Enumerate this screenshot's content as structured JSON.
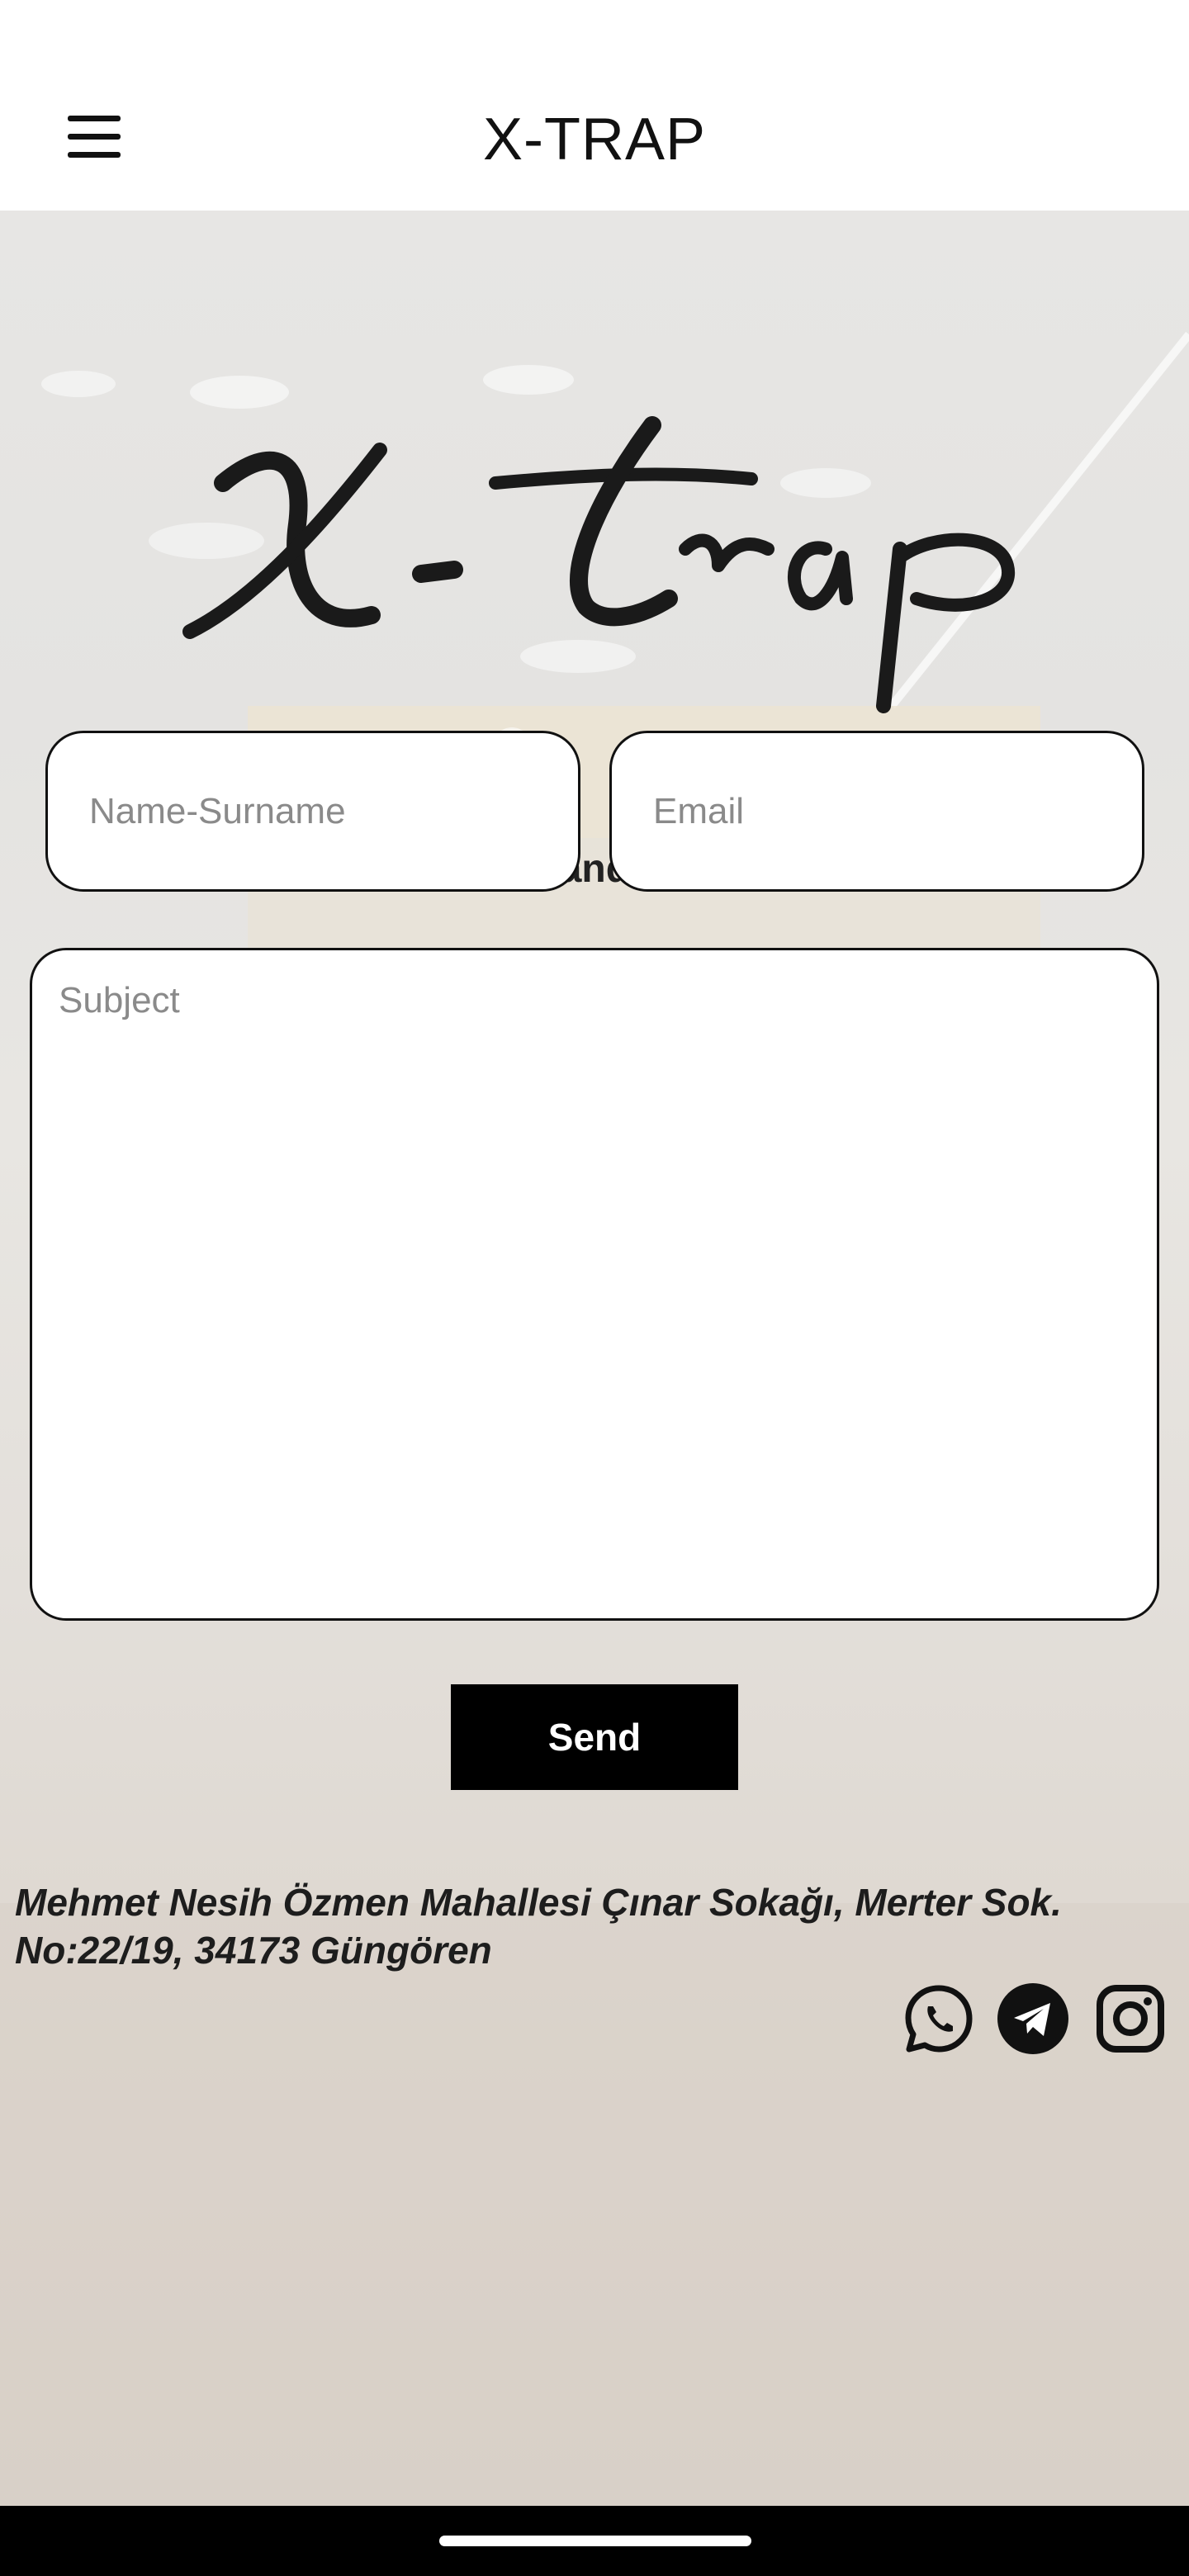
{
  "header": {
    "title": "X-TRAP",
    "menu_icon": "hamburger-menu-icon"
  },
  "logo": {
    "text": "X-Trap"
  },
  "intro": {
    "text": "To contact us, fill out and send the form below."
  },
  "form": {
    "name_placeholder": "Name-Surname",
    "email_placeholder": "Email",
    "subject_placeholder": "Subject",
    "send_label": "Send"
  },
  "footer": {
    "address_line1": "Mehmet Nesih Özmen Mahallesi Çınar Sokağı, Merter Sok.",
    "address_line2": "No:22/19, 34173 Güngören",
    "social": [
      "whatsapp-icon",
      "telegram-icon",
      "instagram-icon"
    ]
  },
  "colors": {
    "accent": "#000000",
    "background": "#e6e4e1",
    "text": "#222222"
  }
}
